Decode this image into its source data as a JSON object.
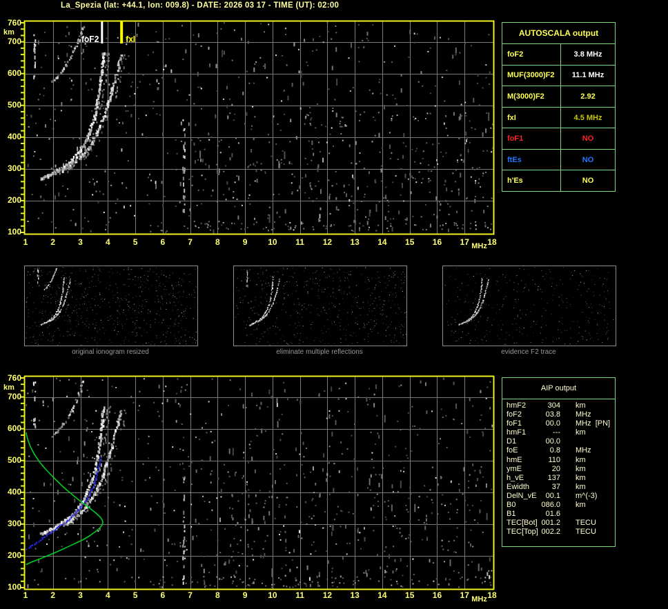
{
  "title": "La_Spezia (lat: +44.1, lon: 009.8) - DATE: 2026 03 17 - TIME (UT): 02:00",
  "colors": {
    "background": "#000000",
    "title_text": "#ffffa0",
    "axis_text": "#ffff70",
    "frame": "#f0f020",
    "grid": "#7a7a7a",
    "table_border": "#7cd87c",
    "yellow": "#ffff55",
    "white": "#ffffff",
    "red": "#ff2222",
    "blue": "#2277ff",
    "dark_yellow": "#c8c800",
    "aip_text": "#ffffd0",
    "caption_text": "#9a9a9a",
    "profile_green": "#00cc22",
    "restored_blue": "#2626e8",
    "marker_foF2": "#ffffff",
    "marker_fxI": "#ffff00"
  },
  "autoscala": {
    "header": "AUTOSCALA output",
    "rows": [
      {
        "label": "foF2",
        "value": "3.8 MHz",
        "label_color": "yellow",
        "value_color": "white"
      },
      {
        "label": "MUF(3000)F2",
        "value": "11.1 MHz",
        "label_color": "yellow",
        "value_color": "white"
      },
      {
        "label": "M(3000)F2",
        "value": "2.92",
        "label_color": "yellow",
        "value_color": "yellow"
      },
      {
        "label": "fxI",
        "value": "4.5 MHz",
        "label_color": "yellow",
        "value_color": "dark_yellow"
      },
      {
        "label": "foF1",
        "value": "NO",
        "label_color": "red",
        "value_color": "red"
      },
      {
        "label": "ftEs",
        "value": "NO",
        "label_color": "blue",
        "value_color": "blue"
      },
      {
        "label": "h'Es",
        "value": "NO",
        "label_color": "yellow",
        "value_color": "yellow"
      }
    ]
  },
  "aip": {
    "header": "AIP output",
    "rows": [
      {
        "label": "hmF2",
        "value": "304",
        "unit": "km",
        "extra": ""
      },
      {
        "label": "foF2",
        "value": "03.8",
        "unit": "MHz",
        "extra": ""
      },
      {
        "label": "foF1",
        "value": "00.0",
        "unit": "MHz",
        "extra": "[PN]"
      },
      {
        "label": "hmF1",
        "value": "---",
        "unit": "km",
        "extra": ""
      },
      {
        "label": "D1",
        "value": "00.0",
        "unit": "",
        "extra": ""
      },
      {
        "label": "foE",
        "value": "0.8",
        "unit": "MHz",
        "extra": ""
      },
      {
        "label": "hmE",
        "value": "110",
        "unit": "km",
        "extra": ""
      },
      {
        "label": "ymE",
        "value": "20",
        "unit": "km",
        "extra": ""
      },
      {
        "label": "h_vE",
        "value": "137",
        "unit": "km",
        "extra": ""
      },
      {
        "label": "Ewidth",
        "value": "37",
        "unit": "km",
        "extra": ""
      },
      {
        "label": "DelN_vE",
        "value": "00.1",
        "unit": "m^(-3)",
        "extra": ""
      },
      {
        "label": "B0",
        "value": "086.0",
        "unit": "km",
        "extra": ""
      },
      {
        "label": "B1",
        "value": "01.6",
        "unit": "",
        "extra": ""
      },
      {
        "label": "TEC[Bot]",
        "value": "001.2",
        "unit": "TECU",
        "extra": ""
      },
      {
        "label": "TEC[Top]",
        "value": "002.2",
        "unit": "TECU",
        "extra": ""
      }
    ]
  },
  "thumbnails": [
    {
      "caption": "original ionogram resized",
      "shows": [
        "o_mode",
        "x_mode",
        "multiple",
        "column_interference"
      ],
      "noise": 640
    },
    {
      "caption": "eliminate multiple reflections",
      "shows": [
        "o_mode",
        "x_mode",
        "column_interference"
      ],
      "noise": 520
    },
    {
      "caption": "evidence F2 trace",
      "shows": [
        "o_mode",
        "x_mode"
      ],
      "noise": 330
    }
  ],
  "chart_data": [
    {
      "type": "scatter",
      "name": "autoscala scaled ionogram",
      "xlabel": "MHz",
      "ylabel": "km",
      "xlim": [
        1,
        18
      ],
      "ylim": [
        100,
        760
      ],
      "x_ticks": [
        1,
        2,
        3,
        4,
        5,
        6,
        7,
        8,
        9,
        10,
        11,
        12,
        13,
        14,
        15,
        16,
        17,
        18
      ],
      "y_ticks": [
        760,
        700,
        600,
        500,
        400,
        300,
        200,
        100
      ],
      "grid": true,
      "series": [
        "o_mode",
        "x_mode",
        "multiple"
      ],
      "columns": [
        {
          "name": "column_interference",
          "mhz": 1.3,
          "km": [
            590,
            752
          ],
          "bright": true,
          "n": 14
        },
        {
          "name": "column_scatter",
          "mhz": 6.75,
          "km": [
            115,
            460
          ],
          "bright": false,
          "n": 26
        }
      ],
      "markers": [
        {
          "label": "foF2",
          "mhz": 3.8,
          "color_key": "marker_foF2"
        },
        {
          "label": "fxI",
          "mhz": 4.5,
          "color_key": "marker_fxI"
        }
      ]
    },
    {
      "type": "scatter",
      "name": "AIP ionogram with electron density profile",
      "xlabel": "MHz",
      "ylabel": "km",
      "xlim": [
        1,
        18
      ],
      "ylim": [
        100,
        760
      ],
      "x_ticks": [
        1,
        2,
        3,
        4,
        5,
        6,
        7,
        8,
        9,
        10,
        11,
        12,
        13,
        14,
        15,
        16,
        17,
        18
      ],
      "y_ticks": [
        760,
        700,
        600,
        500,
        400,
        300,
        200,
        100
      ],
      "grid": true,
      "series": [
        "o_mode",
        "x_mode",
        "multiple"
      ],
      "columns": [
        {
          "name": "column_interference",
          "mhz": 1.3,
          "km": [
            600,
            750
          ],
          "bright": true,
          "n": 12
        },
        {
          "name": "column_scatter",
          "mhz": 6.75,
          "km": [
            115,
            460
          ],
          "bright": false,
          "n": 24
        }
      ],
      "profile_trace": "profile",
      "restored_trace": "restored"
    }
  ],
  "traces": {
    "o_mode": [
      [
        1.55,
        272
      ],
      [
        1.63,
        275
      ],
      [
        1.71,
        278
      ],
      [
        1.79,
        282
      ],
      [
        1.87,
        285
      ],
      [
        1.95,
        289
      ],
      [
        2.03,
        292
      ],
      [
        2.11,
        296
      ],
      [
        2.19,
        300
      ],
      [
        2.27,
        304
      ],
      [
        2.35,
        309
      ],
      [
        2.43,
        314
      ],
      [
        2.51,
        319
      ],
      [
        2.59,
        325
      ],
      [
        2.67,
        331
      ],
      [
        2.75,
        338
      ],
      [
        2.83,
        346
      ],
      [
        2.91,
        355
      ],
      [
        2.99,
        365
      ],
      [
        3.07,
        376
      ],
      [
        3.15,
        389
      ],
      [
        3.23,
        404
      ],
      [
        3.31,
        421
      ],
      [
        3.39,
        441
      ],
      [
        3.47,
        464
      ],
      [
        3.54,
        490
      ],
      [
        3.6,
        517
      ],
      [
        3.66,
        547
      ],
      [
        3.71,
        579
      ],
      [
        3.75,
        611
      ],
      [
        3.78,
        643
      ],
      [
        3.81,
        673
      ]
    ],
    "x_mode": [
      [
        2.28,
        296
      ],
      [
        2.38,
        301
      ],
      [
        2.48,
        306
      ],
      [
        2.58,
        312
      ],
      [
        2.68,
        318
      ],
      [
        2.78,
        325
      ],
      [
        2.88,
        332
      ],
      [
        2.98,
        340
      ],
      [
        3.08,
        349
      ],
      [
        3.18,
        359
      ],
      [
        3.28,
        370
      ],
      [
        3.38,
        383
      ],
      [
        3.48,
        397
      ],
      [
        3.58,
        414
      ],
      [
        3.68,
        433
      ],
      [
        3.78,
        455
      ],
      [
        3.88,
        480
      ],
      [
        3.98,
        508
      ],
      [
        4.08,
        538
      ],
      [
        4.18,
        570
      ],
      [
        4.28,
        602
      ],
      [
        4.36,
        632
      ],
      [
        4.43,
        658
      ]
    ],
    "multiple": [
      [
        1.95,
        576
      ],
      [
        2.03,
        583
      ],
      [
        2.11,
        590
      ],
      [
        2.19,
        598
      ],
      [
        2.27,
        607
      ],
      [
        2.35,
        616
      ],
      [
        2.43,
        626
      ],
      [
        2.51,
        637
      ],
      [
        2.59,
        648
      ],
      [
        2.67,
        661
      ],
      [
        2.75,
        675
      ],
      [
        2.83,
        691
      ],
      [
        2.91,
        709
      ],
      [
        2.99,
        729
      ],
      [
        3.07,
        751
      ]
    ],
    "profile": [
      [
        1.02,
        588
      ],
      [
        1.08,
        566
      ],
      [
        1.18,
        543
      ],
      [
        1.32,
        520
      ],
      [
        1.5,
        497
      ],
      [
        1.72,
        474
      ],
      [
        1.97,
        451
      ],
      [
        2.24,
        428
      ],
      [
        2.52,
        406
      ],
      [
        2.8,
        386
      ],
      [
        3.08,
        367
      ],
      [
        3.34,
        350
      ],
      [
        3.55,
        336
      ],
      [
        3.7,
        324
      ],
      [
        3.79,
        314
      ],
      [
        3.82,
        306
      ],
      [
        3.79,
        297
      ],
      [
        3.7,
        287
      ],
      [
        3.55,
        276
      ],
      [
        3.35,
        264
      ],
      [
        3.12,
        252
      ],
      [
        2.86,
        241
      ],
      [
        2.58,
        230
      ],
      [
        2.3,
        219
      ],
      [
        2.02,
        208
      ],
      [
        1.74,
        198
      ],
      [
        1.48,
        189
      ],
      [
        1.26,
        182
      ],
      [
        1.1,
        176
      ],
      [
        1.02,
        172
      ]
    ],
    "restored": [
      [
        1.02,
        222
      ],
      [
        1.15,
        230
      ],
      [
        1.3,
        239
      ],
      [
        1.45,
        248
      ],
      [
        1.6,
        257
      ],
      [
        1.75,
        266
      ],
      [
        1.9,
        275
      ],
      [
        2.05,
        284
      ],
      [
        2.2,
        293
      ],
      [
        2.35,
        303
      ],
      [
        2.5,
        313
      ],
      [
        2.65,
        324
      ],
      [
        2.8,
        336
      ],
      [
        2.95,
        350
      ],
      [
        3.1,
        366
      ],
      [
        3.25,
        385
      ],
      [
        3.38,
        407
      ],
      [
        3.5,
        432
      ],
      [
        3.6,
        460
      ],
      [
        3.68,
        490
      ],
      [
        3.74,
        512
      ]
    ]
  }
}
